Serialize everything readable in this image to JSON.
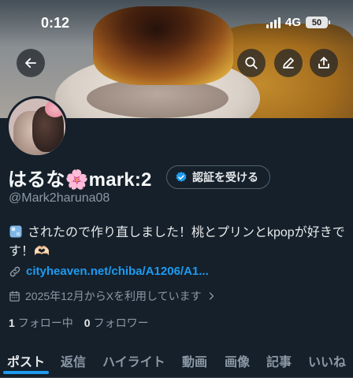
{
  "status_bar": {
    "time": "0:12",
    "network": "4G",
    "battery": "50"
  },
  "profile": {
    "display_name": "はるな🌸mark:2",
    "verify_label": "認証を受ける",
    "handle": "@Mark2haruna08",
    "bio": "されたので作り直しました！桃とプリンとkpopが好きです！🫶🏻",
    "link": "cityheaven.net/chiba/A1206/A1...",
    "joined": "2025年12月からXを利用しています",
    "following_count": "1",
    "following_label": "フォロー中",
    "followers_count": "0",
    "followers_label": "フォロワー"
  },
  "tabs": [
    "ポスト",
    "返信",
    "ハイライト",
    "動画",
    "画像",
    "記事",
    "いいね"
  ],
  "icons": {
    "back": "back-arrow-icon",
    "search": "search-icon",
    "edit": "pencil-icon",
    "share": "share-icon",
    "verified": "verified-badge-icon",
    "link": "link-icon",
    "calendar": "calendar-icon",
    "bio_emoji": "ice-cube-icon"
  },
  "colors": {
    "background": "#15202b",
    "accent": "#1d9bf0",
    "muted": "#8b98a5",
    "text": "#e7e9ea"
  }
}
